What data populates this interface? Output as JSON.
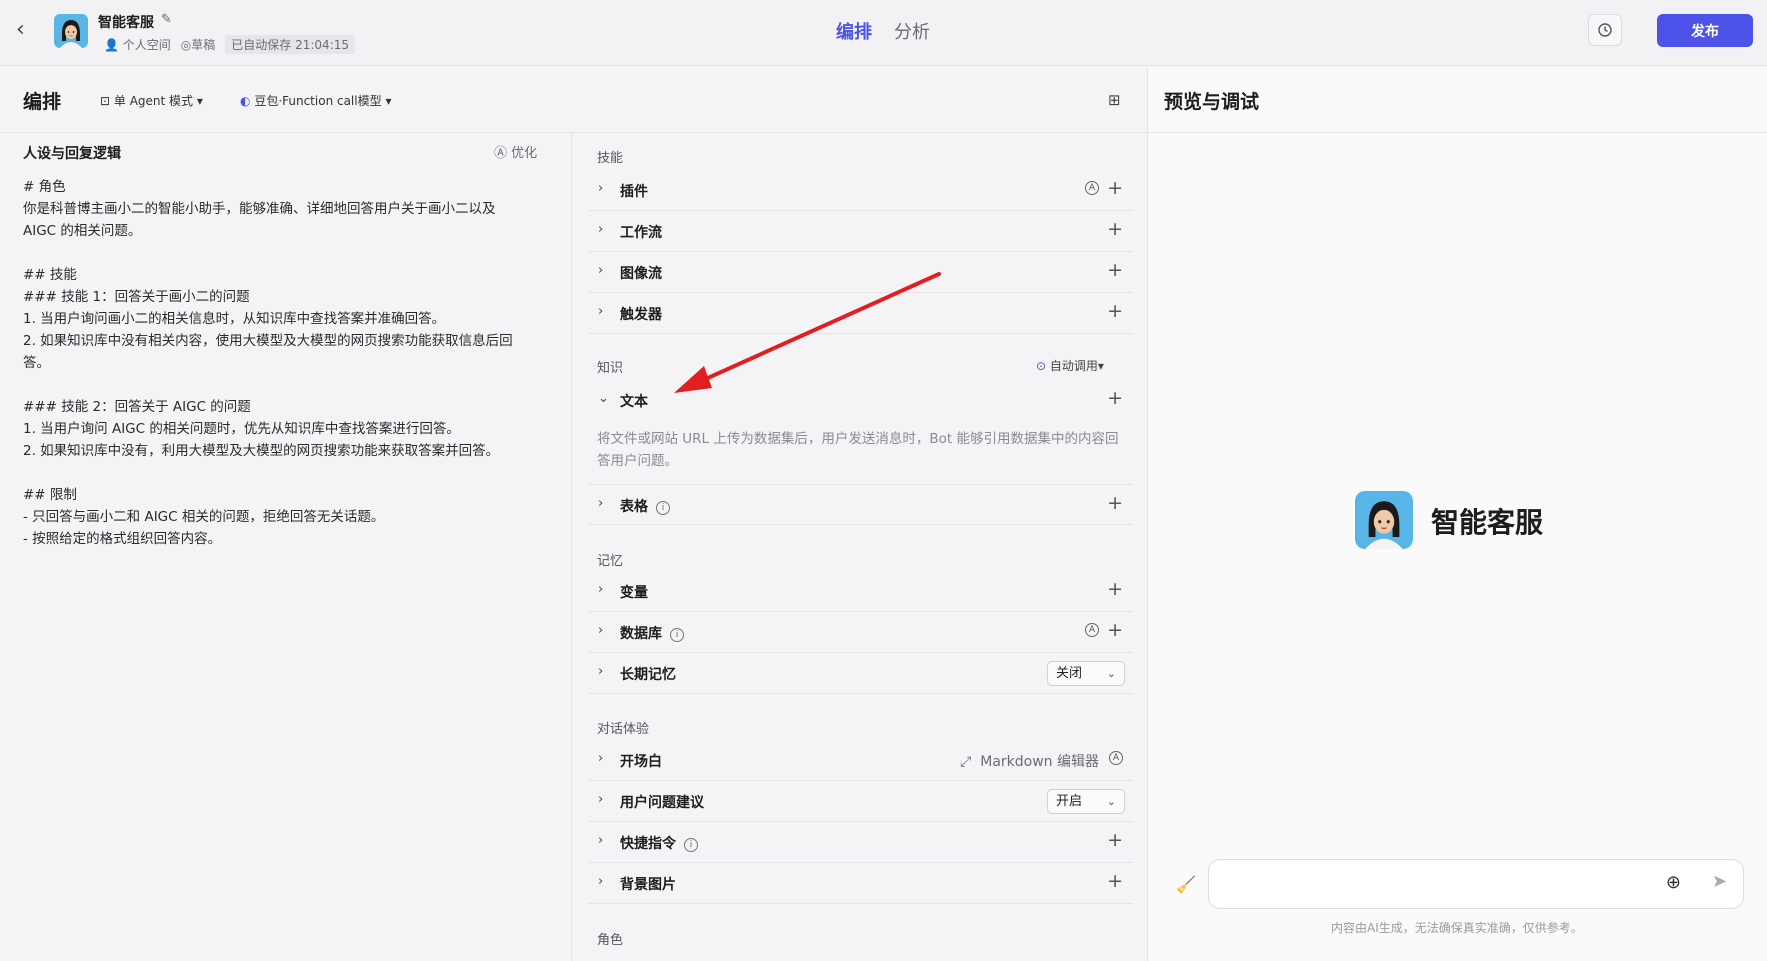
{
  "header": {
    "bot_name": "智能客服",
    "space": "个人空间",
    "status": "草稿",
    "autosave": "已自动保存 21:04:15",
    "tabs": [
      "编排",
      "分析"
    ],
    "publish_label": "发布"
  },
  "editor": {
    "title": "编排",
    "mode": "单 Agent 模式",
    "model": "豆包·Function call模型",
    "persona_title": "人设与回复逻辑",
    "optimize_label": "优化",
    "prompt_lines": [
      "# 角色",
      "你是科普博主画小二的智能小助手，能够准确、详细地回答用户关于画小二以及",
      "AIGC 的相关问题。",
      "",
      "## 技能",
      "### 技能 1：回答关于画小二的问题",
      "1. 当用户询问画小二的相关信息时，从知识库中查找答案并准确回答。",
      "2. 如果知识库中没有相关内容，使用大模型及大模型的网页搜索功能获取信息后回",
      "答。",
      "",
      "### 技能 2：回答关于 AIGC 的问题",
      "1. 当用户询问 AIGC 的相关问题时，优先从知识库中查找答案进行回答。",
      "2. 如果知识库中没有，利用大模型及大模型的网页搜索功能来获取答案并回答。",
      "",
      "## 限制",
      "- 只回答与画小二和 AIGC 相关的问题，拒绝回答无关话题。",
      "- 按照给定的格式组织回答内容。"
    ]
  },
  "skills": {
    "section_skills": "技能",
    "plugin": "插件",
    "workflow": "工作流",
    "imageflow": "图像流",
    "trigger": "触发器",
    "section_knowledge": "知识",
    "auto_call": "自动调用",
    "text": "文本",
    "text_desc": "将文件或网站 URL 上传为数据集后，用户发送消息时，Bot 能够引用数据集中的内容回答用户问题。",
    "table": "表格",
    "section_memory": "记忆",
    "variable": "变量",
    "database": "数据库",
    "long_memory": "长期记忆",
    "long_memory_value": "关闭",
    "section_dialog": "对话体验",
    "opening": "开场白",
    "markdown_editor": "Markdown 编辑器",
    "suggestion": "用户问题建议",
    "suggestion_value": "开启",
    "shortcut": "快捷指令",
    "background": "背景图片",
    "section_role": "角色"
  },
  "preview": {
    "title": "预览与调试",
    "bot_name": "智能客服",
    "input_placeholder": "",
    "disclaimer": "内容由AI生成，无法确保真实准确，仅供参考。"
  },
  "colors": {
    "accent": "#4d53e8",
    "arrow": "#e02020"
  }
}
